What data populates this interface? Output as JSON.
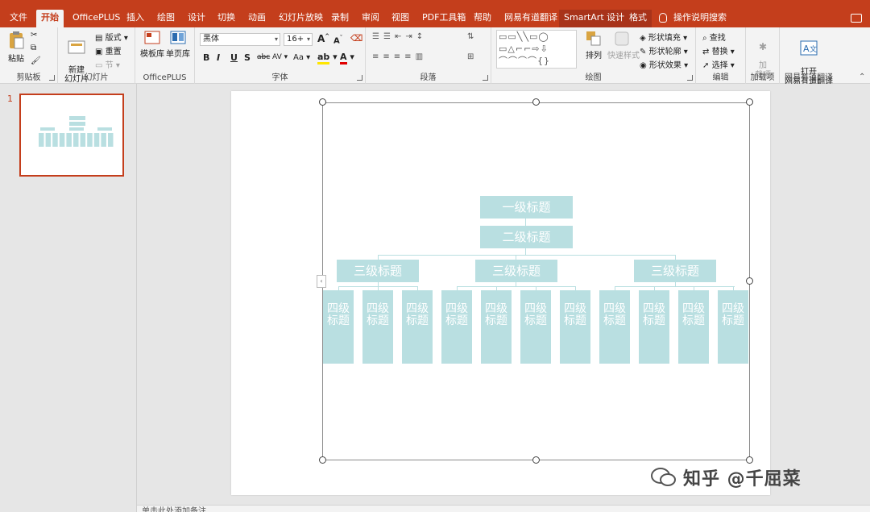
{
  "menu": {
    "tabs": [
      "文件",
      "开始",
      "OfficePLUS",
      "插入",
      "绘图",
      "设计",
      "切换",
      "动画",
      "幻灯片放映",
      "录制",
      "审阅",
      "视图",
      "PDF工具箱",
      "帮助",
      "网易有道翻译",
      "SmartArt 设计",
      "格式"
    ],
    "active_tab": "开始",
    "search_label": "操作说明搜索"
  },
  "ribbon": {
    "clipboard": {
      "paste": "粘贴",
      "group": "剪贴板"
    },
    "slides": {
      "new_slide": "新建\n幻灯片",
      "layout": "版式",
      "reset": "重置",
      "section": "节",
      "group": "幻灯片"
    },
    "officeplus": {
      "template": "模板库",
      "single_page": "单页库",
      "group": "OfficePLUS"
    },
    "font": {
      "family": "黑体",
      "size": "16+",
      "group": "字体",
      "bold": "B",
      "italic": "I",
      "underline": "U",
      "shadow": "S",
      "strike": "abc",
      "spacing": "AV",
      "case": "Aa",
      "grow": "A",
      "shrink": "A"
    },
    "paragraph": {
      "group": "段落"
    },
    "drawing": {
      "arrange": "排列",
      "quick_styles": "快速样式",
      "fill": "形状填充",
      "outline": "形状轮廓",
      "effects": "形状效果",
      "group": "绘图"
    },
    "editing": {
      "find": "查找",
      "replace": "替换",
      "select": "选择",
      "group": "编辑"
    },
    "addins": {
      "label": "加\n载项",
      "group": "加载项"
    },
    "youdao": {
      "open": "打开\n网易有道翻译",
      "group": "网易有道翻译"
    }
  },
  "thumbnail": {
    "number": "1"
  },
  "org_chart": {
    "level1": "一级标题",
    "level2": "二级标题",
    "level3": [
      "三级标题",
      "三级标题",
      "三级标题"
    ],
    "level4": [
      "四级标题",
      "四级标题",
      "四级标题",
      "四级标题",
      "四级标题",
      "四级标题",
      "四级标题",
      "四级标题",
      "四级标题",
      "四级标题",
      "四级标题"
    ],
    "color": "#b9dfe1"
  },
  "notes": {
    "placeholder": "单击此处添加备注"
  },
  "watermark": {
    "text": "知乎 @千屈菜"
  },
  "colors": {
    "accent": "#c43e1c",
    "ribbon_bg": "#f3f3f3",
    "canvas_bg": "#e6e6e6"
  }
}
